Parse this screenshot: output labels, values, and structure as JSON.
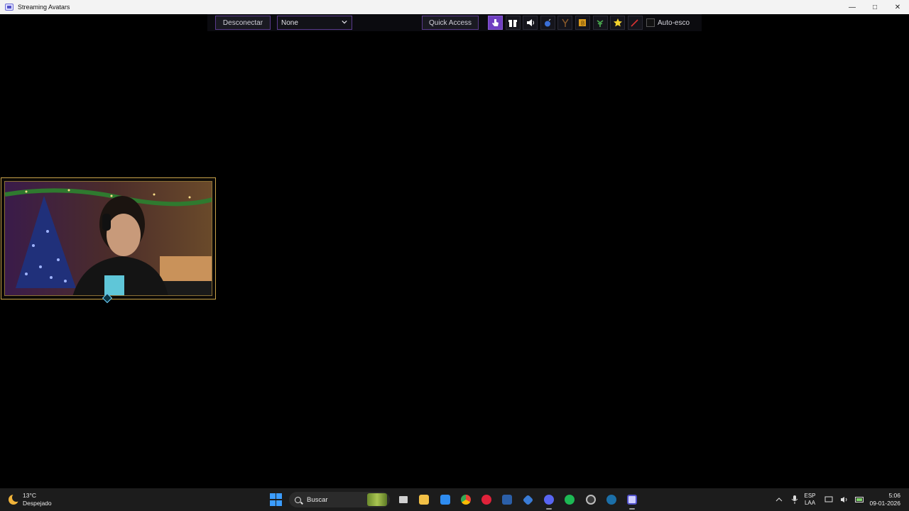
{
  "window": {
    "title": "Streaming Avatars"
  },
  "window_controls": {
    "minimize": "—",
    "maximize": "□",
    "close": "✕"
  },
  "toolbar": {
    "disconnect_label": "Desconectar",
    "select_value": "None",
    "quick_access_label": "Quick Access",
    "icons": [
      "hand-pointer-icon",
      "gift-icon",
      "speaker-icon",
      "bomb-icon",
      "slingshot-icon",
      "bits-icon",
      "plant-icon",
      "star-icon",
      "sword-icon"
    ],
    "autoescape_label": "Auto-esco",
    "autoescape_checked": false,
    "accent": "#6f3fc1"
  },
  "avatar_frame": {
    "border_color": "#c8a24a"
  },
  "taskbar": {
    "weather": {
      "temp": "13°C",
      "condition": "Despejado"
    },
    "search_placeholder": "Buscar",
    "apps": [
      "task-view-icon",
      "file-explorer-icon",
      "store-icon",
      "chrome-icon",
      "app-red-icon",
      "vscode-icon",
      "app-blue-icon",
      "discord-icon",
      "spotify-icon",
      "app-gear-icon",
      "steam-icon",
      "streaming-avatars-icon"
    ],
    "lang": {
      "top": "ESP",
      "bottom": "LAA"
    },
    "clock": {
      "time": "5:06",
      "date": "09-01-2026"
    }
  }
}
